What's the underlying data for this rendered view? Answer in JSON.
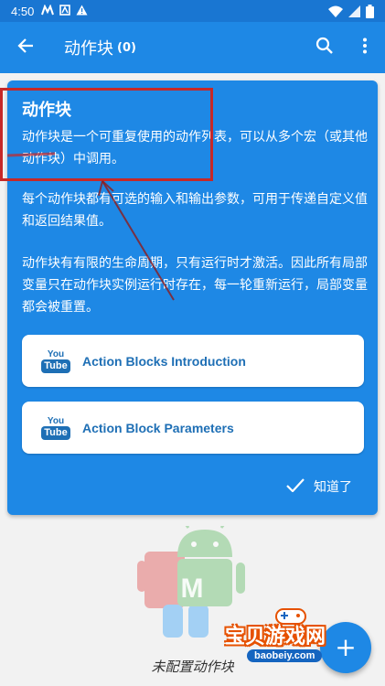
{
  "status_bar": {
    "time": "4:50",
    "icons": [
      "m-notification-icon",
      "a-notification-icon",
      "warning-icon"
    ],
    "right_icons": [
      "wifi-icon",
      "battery-icon"
    ]
  },
  "app_bar": {
    "title": "动作块",
    "count": "(0)",
    "icons": [
      "back-arrow-icon",
      "search-icon",
      "more-vert-icon"
    ],
    "color": "#1e88e5"
  },
  "info_card": {
    "title": "动作块",
    "paragraphs": [
      "动作块是一个可重复使用的动作列表，可以从多个宏（或其他动作块）中调用。",
      "每个动作块都有可选的输入和输出参数，可用于传递自定义值和返回结果值。",
      "动作块有有限的生命周期，只有运行时才激活。因此所有局部变量只在动作块实例运行时存在，每一轮重新运行，局部变量都会被重置。"
    ],
    "links": [
      {
        "label": "Action Blocks Introduction",
        "icon_you": "You",
        "icon_tube": "Tube"
      },
      {
        "label": "Action Block Parameters",
        "icon_you": "You",
        "icon_tube": "Tube"
      }
    ],
    "dismiss_label": "知道了",
    "link_color": "#1e6fb5"
  },
  "annotation": {
    "color": "#c62828"
  },
  "empty_state": {
    "text": "未配置动作块",
    "logo_letter": "M"
  },
  "fab": {
    "label": "+"
  },
  "watermark": {
    "main": "宝贝游戏网",
    "sub": "baobeiy.com"
  }
}
